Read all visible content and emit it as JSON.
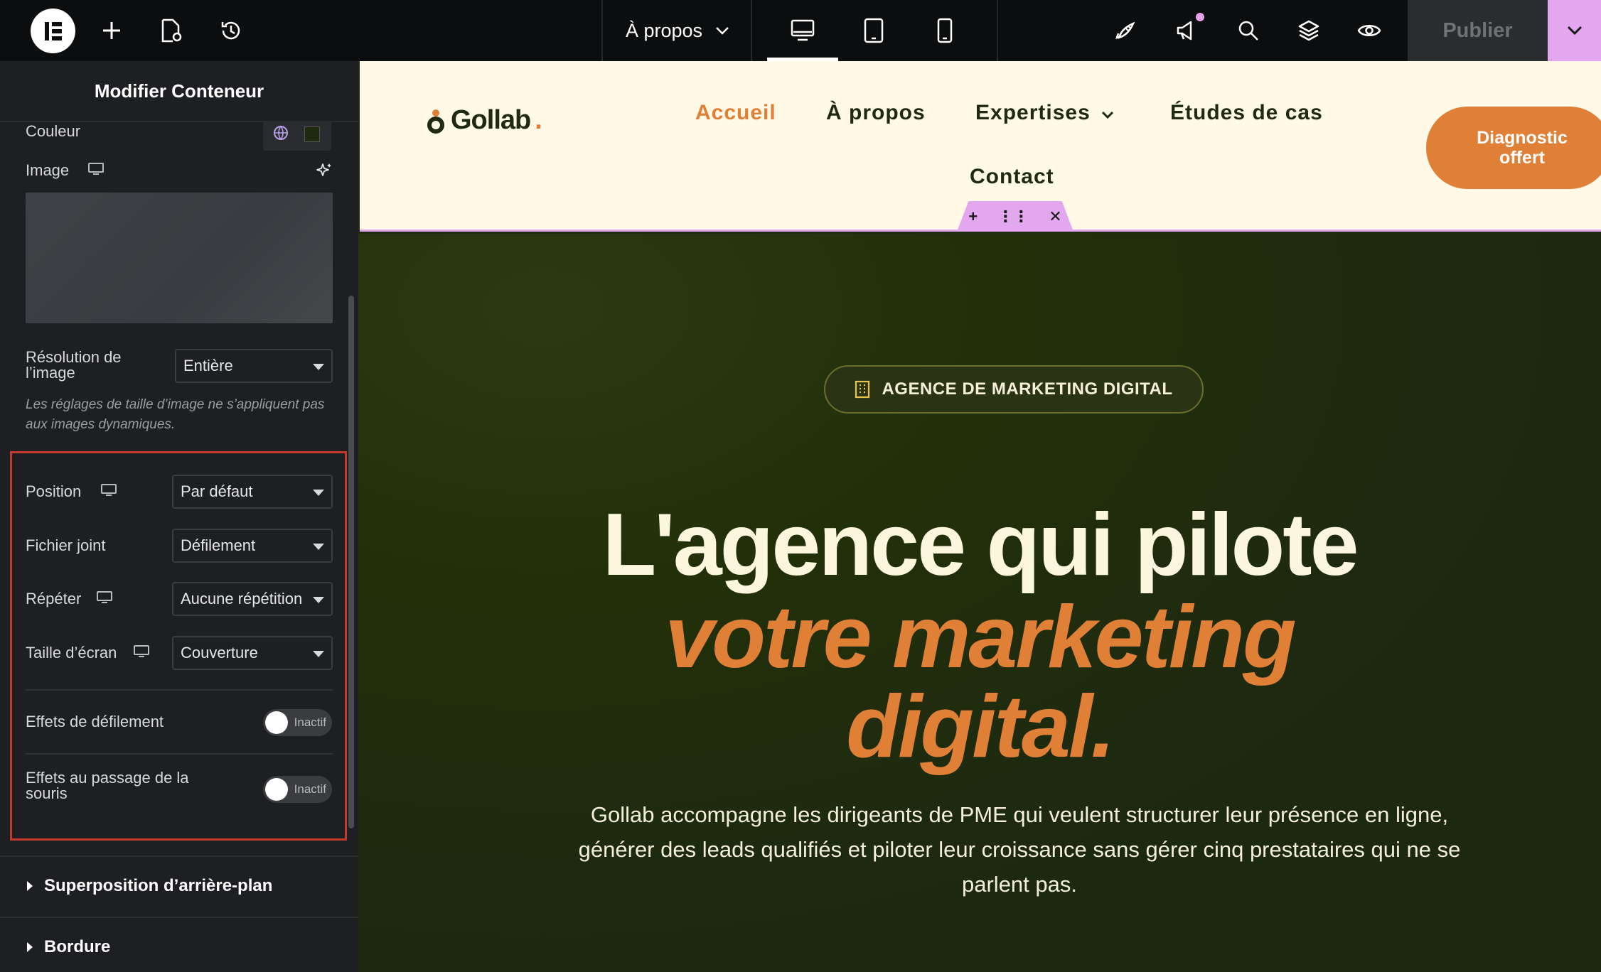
{
  "topbar": {
    "page_select": "À propos",
    "publish_label": "Publier",
    "colors": {
      "accent": "#e3a7f0",
      "bg": "#0c0d0e"
    }
  },
  "panel": {
    "title": "Modifier Conteneur",
    "couleur_label": "Couleur",
    "image_label": "Image",
    "resolution_label": "Résolution de l’image",
    "resolution_value": "Entière",
    "hint": "Les réglages de taille d’image ne s’appliquent pas aux images dynamiques.",
    "position_label": "Position",
    "position_value": "Par défaut",
    "attachment_label": "Fichier joint",
    "attachment_value": "Défilement",
    "repeat_label": "Répéter",
    "repeat_value": "Aucune répétition",
    "size_label": "Taille d’écran",
    "size_value": "Couverture",
    "scroll_effects_label": "Effets de défilement",
    "scroll_effects_state": "Inactif",
    "hover_effects_label": "Effets au passage de la souris",
    "hover_effects_state": "Inactif",
    "section_overlay": "Superposition d’arrière-plan",
    "section_border": "Bordure"
  },
  "site": {
    "brand": "Gollab",
    "brand_dot": ".",
    "nav": [
      "Accueil",
      "À propos",
      "Expertises",
      "Études de cas",
      "Contact"
    ],
    "cta": "Diagnostic offert",
    "badge": "AGENCE DE MARKETING DIGITAL",
    "headline_1": "L'agence qui pilote",
    "headline_2": "votre marketing",
    "headline_3": "digital.",
    "lead": "Gollab accompagne les dirigeants de PME qui veulent structurer leur présence en ligne, générer des leads qualifiés et piloter leur croissance sans gérer cinq prestataires qui ne se parlent pas.",
    "colors": {
      "cream": "#fff9e6",
      "orange": "#e07f36",
      "dark_green": "#1f2a10"
    }
  }
}
